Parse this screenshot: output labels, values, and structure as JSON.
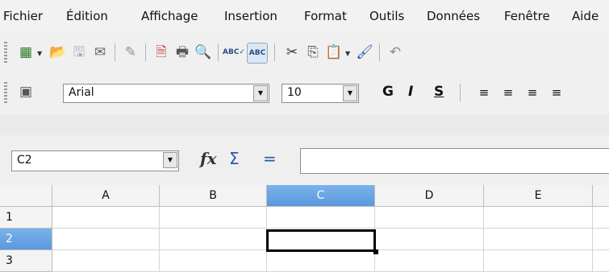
{
  "menubar": {
    "items": [
      {
        "label": "Fichier"
      },
      {
        "label": "Édition"
      },
      {
        "label": "Affichage"
      },
      {
        "label": "Insertion"
      },
      {
        "label": "Format"
      },
      {
        "label": "Outils"
      },
      {
        "label": "Données"
      },
      {
        "label": "Fenêtre"
      },
      {
        "label": "Aide"
      }
    ]
  },
  "toolbar_standard": {
    "icons": [
      "new-document-icon",
      "open-folder-icon",
      "save-icon",
      "email-icon",
      "edit-file-icon",
      "export-pdf-icon",
      "print-icon",
      "page-preview-icon",
      "spellcheck-icon",
      "autospellcheck-icon",
      "cut-icon",
      "copy-icon",
      "paste-icon",
      "clone-formatting-icon",
      "undo-icon"
    ]
  },
  "toolbar_formatting": {
    "font_name": "Arial",
    "font_size": "10",
    "bold_label": "G",
    "italic_label": "I",
    "underline_label": "S"
  },
  "formula_bar": {
    "name_box": "C2",
    "function_wizard_glyph": "fx",
    "sum_glyph": "Σ",
    "equals_glyph": "=",
    "input_value": ""
  },
  "sheet": {
    "columns": [
      "A",
      "B",
      "C",
      "D",
      "E"
    ],
    "rows": [
      "1",
      "2",
      "3"
    ],
    "selected_column": "C",
    "selected_row": "2",
    "selection_color": "#5a98dd"
  }
}
